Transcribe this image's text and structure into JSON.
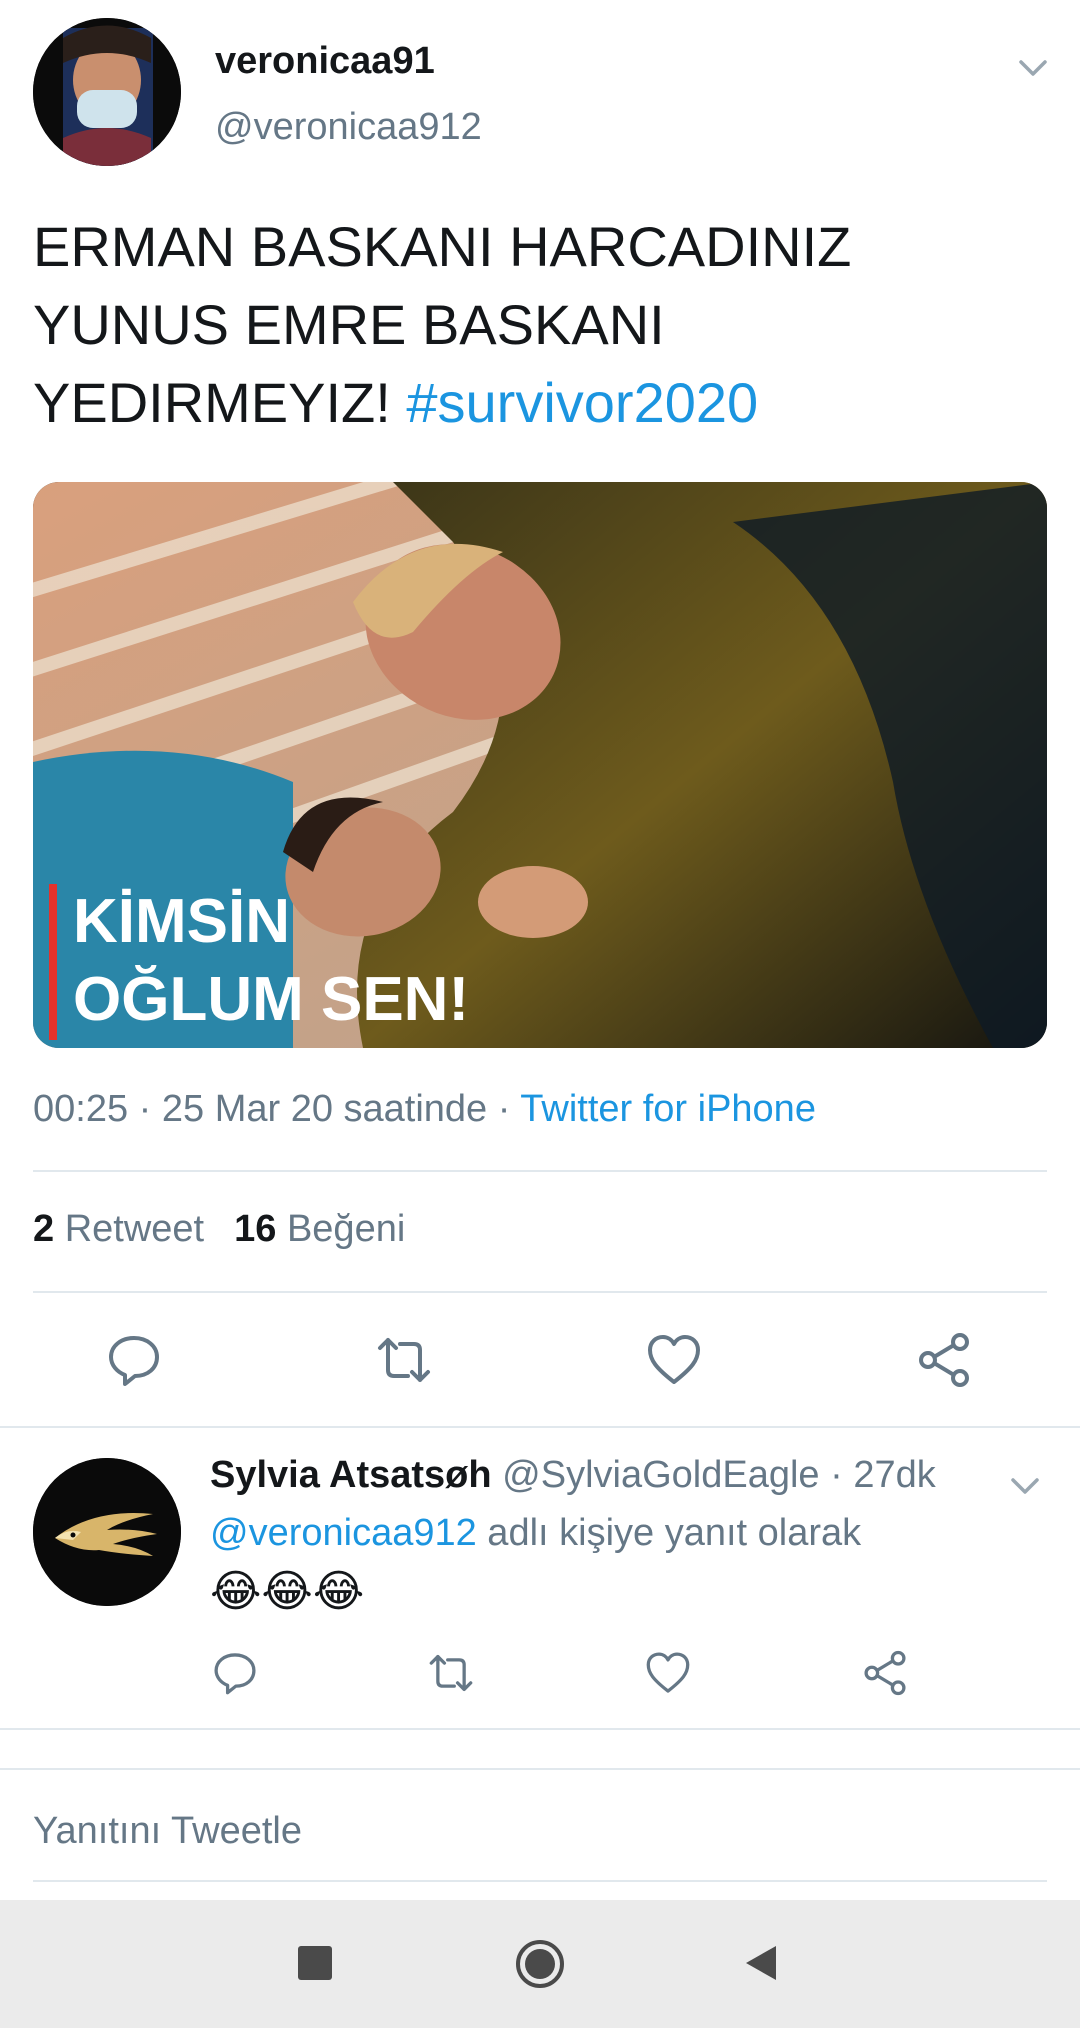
{
  "tweet": {
    "display_name": "veronicaa91",
    "handle": "@veronicaa912",
    "text_lines": [
      "ERMAN BASKANI HARCADINIZ",
      "YUNUS EMRE BASKANI",
      "YEDIRMEYIZ!"
    ],
    "hashtag": "#survivor2020",
    "media_caption_line1": "KİMSİN",
    "media_caption_line2": "OĞLUM SEN!",
    "timestamp": "00:25 · 25 Mar 20 saatinde · ",
    "source": "Twitter for iPhone",
    "retweet_count": "2",
    "retweet_label": "Retweet",
    "like_count": "16",
    "like_label": "Beğeni"
  },
  "actions": {
    "reply_icon": "reply-icon",
    "retweet_icon": "retweet-icon",
    "like_icon": "heart-icon",
    "share_icon": "share-icon"
  },
  "reply": {
    "display_name": "Sylvia Atsatsøh",
    "handle_time": " @SylviaGoldEagle · 27dk",
    "mention": "@veronicaa912",
    "reply_suffix": " adlı kişiye yanıt olarak",
    "text": "😂😂😂"
  },
  "compose": {
    "placeholder": "Yanıtını Tweetle"
  },
  "colors": {
    "accent": "#1b95e0",
    "muted": "#657786",
    "divider": "#e1e8ed"
  }
}
